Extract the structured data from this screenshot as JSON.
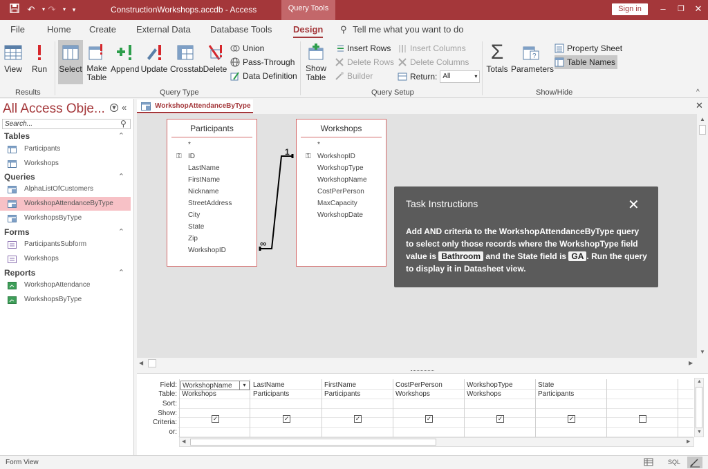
{
  "titlebar": {
    "doc_title": "ConstructionWorkshops.accdb - Access",
    "context_tab": "Query Tools",
    "signin": "Sign in",
    "quick_access": [
      "save",
      "undo",
      "redo",
      "customize"
    ]
  },
  "tabs": [
    {
      "label": "File"
    },
    {
      "label": "Home"
    },
    {
      "label": "Create"
    },
    {
      "label": "External Data"
    },
    {
      "label": "Database Tools"
    },
    {
      "label": "Design"
    },
    {
      "label": "Tell me what you want to do"
    }
  ],
  "ribbon": {
    "results": {
      "label": "Results",
      "view": "View",
      "run": "Run"
    },
    "query_type": {
      "label": "Query Type",
      "select": "Select",
      "make_table": "Make Table",
      "append": "Append",
      "update": "Update",
      "crosstab": "Crosstab",
      "delete": "Delete",
      "union": "Union",
      "pass_through": "Pass-Through",
      "data_definition": "Data Definition"
    },
    "query_setup": {
      "label": "Query Setup",
      "show_table": "Show Table",
      "insert_rows": "Insert Rows",
      "delete_rows": "Delete Rows",
      "builder": "Builder",
      "insert_columns": "Insert Columns",
      "delete_columns": "Delete Columns",
      "return_label": "Return:",
      "return_value": "All"
    },
    "show_hide": {
      "label": "Show/Hide",
      "totals": "Totals",
      "parameters": "Parameters",
      "property_sheet": "Property Sheet",
      "table_names": "Table Names"
    }
  },
  "nav": {
    "title": "All Access Obje...",
    "search_placeholder": "Search...",
    "groups": [
      {
        "name": "Tables",
        "items": [
          "Participants",
          "Workshops"
        ]
      },
      {
        "name": "Queries",
        "items": [
          "AlphaListOfCustomers",
          "WorkshopAttendanceByType",
          "WorkshopsByType"
        ]
      },
      {
        "name": "Forms",
        "items": [
          "ParticipantsSubform",
          "Workshops"
        ]
      },
      {
        "name": "Reports",
        "items": [
          "WorkshopAttendance",
          "WorkshopsByType"
        ]
      }
    ]
  },
  "doc_tab": "WorkshopAttendanceByType",
  "design": {
    "participants": {
      "title": "Participants",
      "fields": [
        "*",
        "ID",
        "LastName",
        "FirstName",
        "Nickname",
        "StreetAddress",
        "City",
        "State",
        "Zip",
        "WorkshopID"
      ]
    },
    "workshops": {
      "title": "Workshops",
      "fields": [
        "*",
        "WorkshopID",
        "WorkshopType",
        "WorkshopName",
        "CostPerPerson",
        "MaxCapacity",
        "WorkshopDate"
      ]
    },
    "relation": {
      "one": "1",
      "many": "∞"
    }
  },
  "task": {
    "title": "Task Instructions",
    "text_1": "Add AND criteria to the WorkshopAttendanceByType query to select only those records where the WorkshopType field value is ",
    "value_1": "Bathroom",
    "text_2": " and the State field is ",
    "value_2": "GA",
    "text_3": ". Run the query to display it in Datasheet view."
  },
  "qbe": {
    "row_labels": [
      "Field:",
      "Table:",
      "Sort:",
      "Show:",
      "Criteria:",
      "or:"
    ],
    "columns": [
      {
        "field": "WorkshopName",
        "table": "Workshops",
        "show": true
      },
      {
        "field": "LastName",
        "table": "Participants",
        "show": true
      },
      {
        "field": "FirstName",
        "table": "Participants",
        "show": true
      },
      {
        "field": "CostPerPerson",
        "table": "Workshops",
        "show": true
      },
      {
        "field": "WorkshopType",
        "table": "Workshops",
        "show": true
      },
      {
        "field": "State",
        "table": "Participants",
        "show": true
      },
      {
        "field": "",
        "table": "",
        "show": false
      }
    ]
  },
  "status": {
    "text": "Form View",
    "sql": "SQL"
  },
  "colors": {
    "accent": "#a4373a",
    "selected_nav": "#f7c1c6"
  }
}
